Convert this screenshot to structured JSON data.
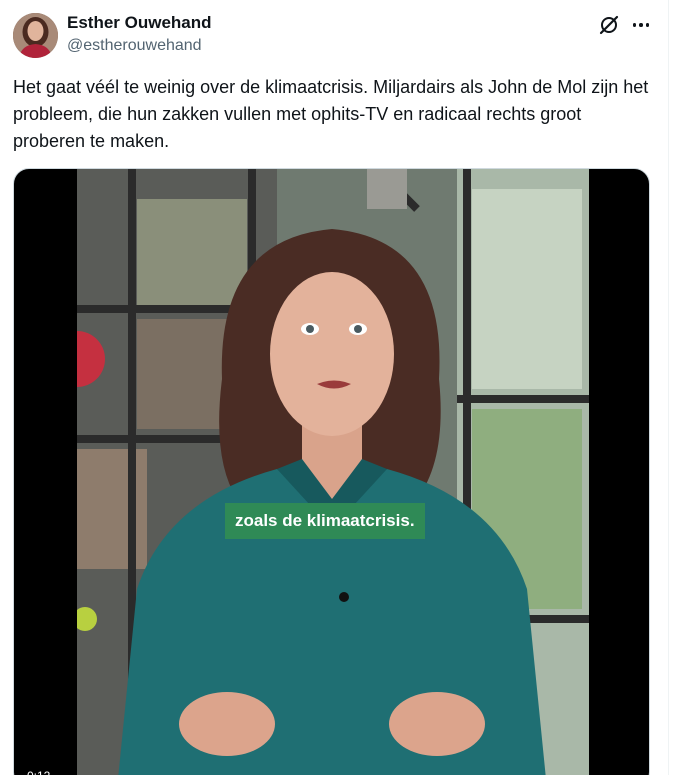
{
  "author": {
    "display_name": "Esther Ouwehand",
    "handle": "@estherouwehand",
    "avatar_icon": "profile-photo"
  },
  "icons": {
    "grok": "grok-icon",
    "more": "more-options-icon"
  },
  "tweet": {
    "text": "Het gaat véél te weinig over de klimaatcrisis. Miljardairs als John de Mol zijn het probleem, die hun zakken vullen met ophits-TV en radicaal rechts groot proberen te maken."
  },
  "video": {
    "caption": "zoals de klimaatcrisis.",
    "timestamp": "0:12"
  },
  "colors": {
    "caption_bg": "#2f8a56",
    "shirt": "#1f6f73",
    "text_primary": "#0f1419",
    "text_secondary": "#536471"
  }
}
